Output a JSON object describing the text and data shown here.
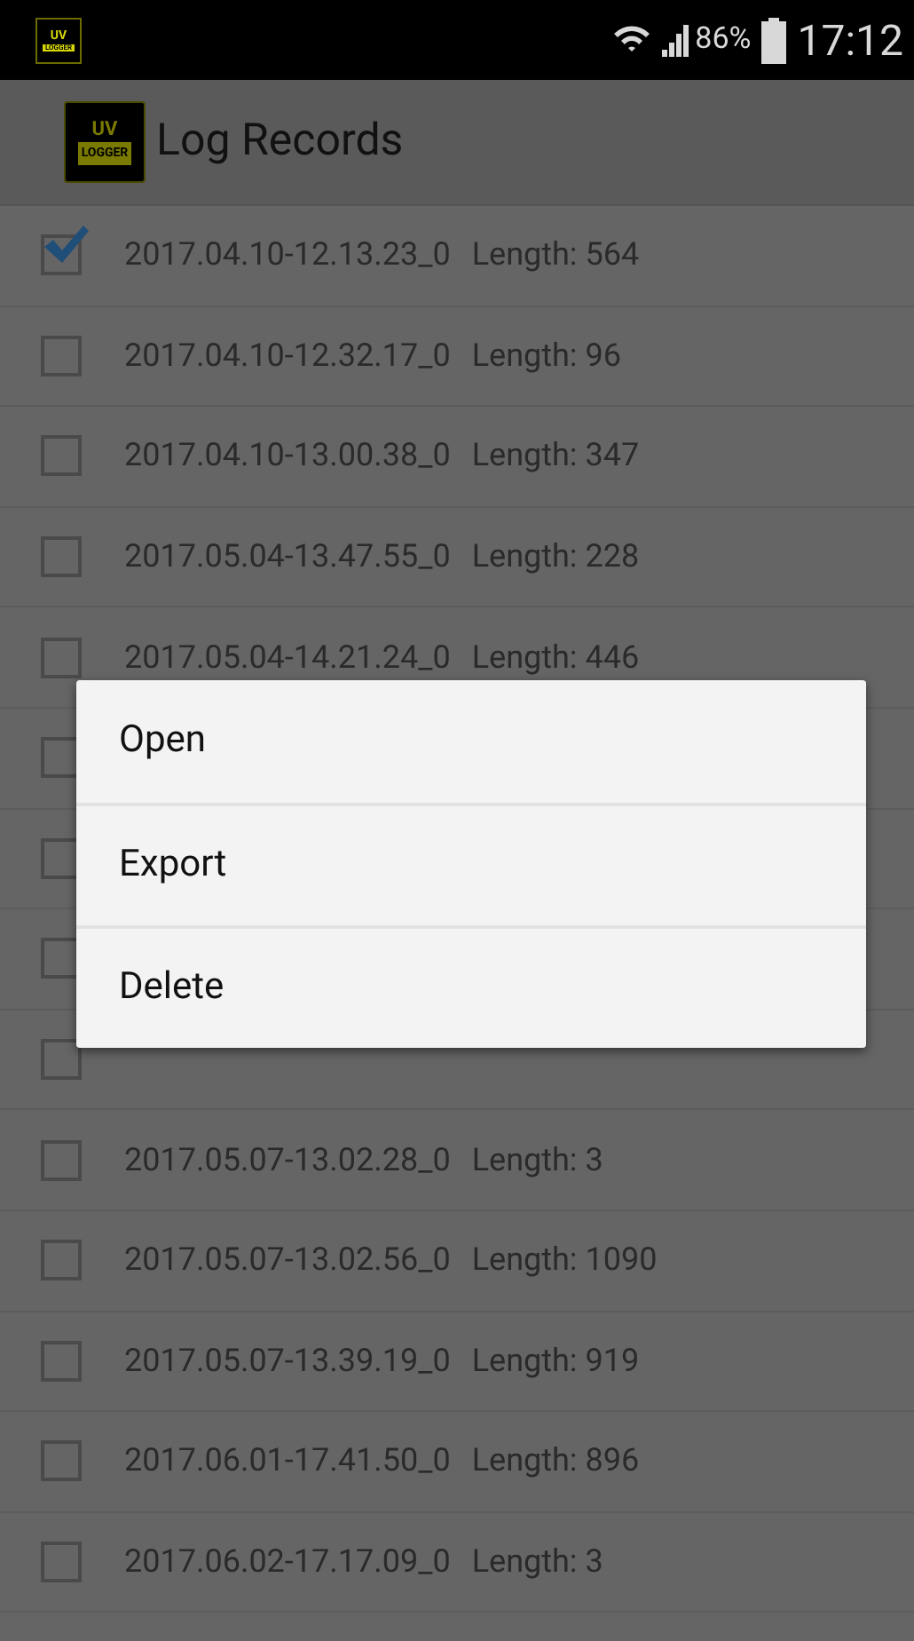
{
  "status_bar": {
    "battery_percent": "86%",
    "time": "17:12"
  },
  "status_logo": {
    "top": "UV",
    "bottom": "LOGGER"
  },
  "app_bar": {
    "logo_top": "UV",
    "logo_bottom": "LOGGER",
    "title": "Log Records"
  },
  "records": [
    {
      "name": "2017.04.10-12.13.23_0",
      "length": "Length: 564",
      "checked": true
    },
    {
      "name": "2017.04.10-12.32.17_0",
      "length": "Length: 96",
      "checked": false
    },
    {
      "name": "2017.04.10-13.00.38_0",
      "length": "Length: 347",
      "checked": false
    },
    {
      "name": "2017.05.04-13.47.55_0",
      "length": "Length: 228",
      "checked": false
    },
    {
      "name": "2017.05.04-14.21.24_0",
      "length": "Length: 446",
      "checked": false
    },
    {
      "checked": false
    },
    {
      "checked": false
    },
    {
      "checked": false
    },
    {
      "checked": false
    },
    {
      "name": "2017.05.07-13.02.28_0",
      "length": "Length: 3",
      "checked": false
    },
    {
      "name": "2017.05.07-13.02.56_0",
      "length": "Length: 1090",
      "checked": false
    },
    {
      "name": "2017.05.07-13.39.19_0",
      "length": "Length: 919",
      "checked": false
    },
    {
      "name": "2017.06.01-17.41.50_0",
      "length": "Length: 896",
      "checked": false
    },
    {
      "name": "2017.06.02-17.17.09_0",
      "length": "Length: 3",
      "checked": false
    }
  ],
  "context_menu": {
    "items": [
      "Open",
      "Export",
      "Delete"
    ]
  }
}
